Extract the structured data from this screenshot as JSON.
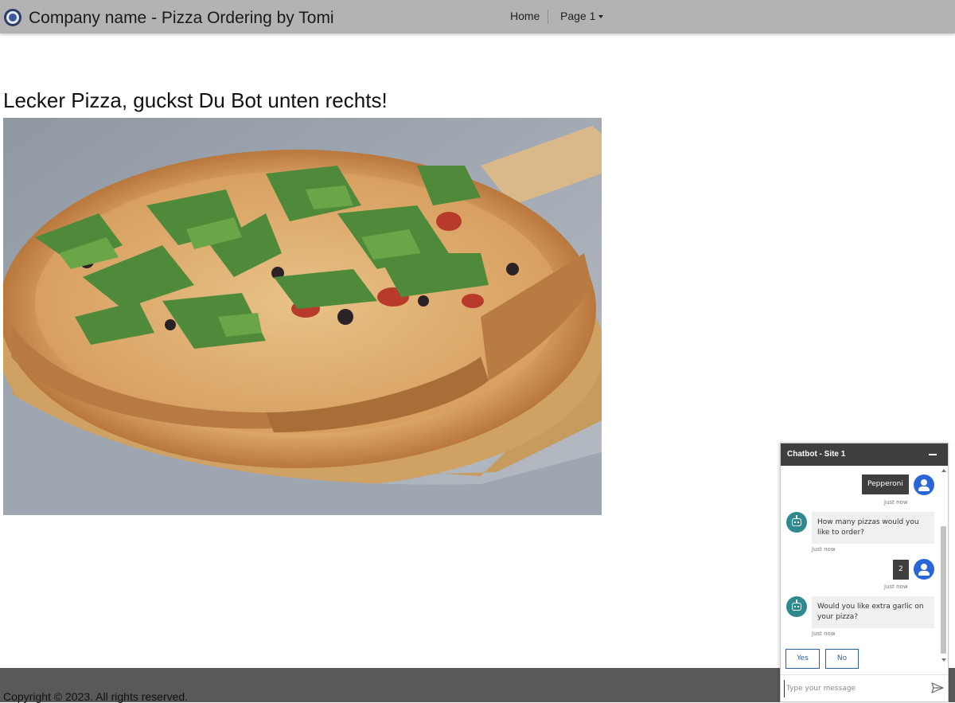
{
  "navbar": {
    "brand": "Company name - Pizza Ordering by Tomi",
    "links": {
      "home": "Home",
      "page1": "Page 1"
    }
  },
  "main": {
    "headline": "Lecker Pizza, guckst Du Bot unten rechts!"
  },
  "footer": {
    "copyright": "Copyright © 2023. All rights reserved."
  },
  "chatbot": {
    "title": "Chatbot - Site 1",
    "messages": [
      {
        "from": "user",
        "text": "Pepperoni",
        "time": "Just now"
      },
      {
        "from": "bot",
        "text": "How many pizzas would you like to order?",
        "time": "Just now"
      },
      {
        "from": "user",
        "text": "2",
        "time": "Just now"
      },
      {
        "from": "bot",
        "text": "Would you like extra garlic on your pizza?",
        "time": "Just now"
      }
    ],
    "suggested_actions": [
      "Yes",
      "No"
    ],
    "input_placeholder": "Type your message"
  },
  "colors": {
    "navbar_bg": "#b4b2b2",
    "footer_bg": "#5a5858",
    "chat_header_bg": "#3f3d3d",
    "user_avatar": "#2b66d8",
    "bot_avatar": "#2e8a8e",
    "suggestion_border": "#2a5fa8"
  }
}
